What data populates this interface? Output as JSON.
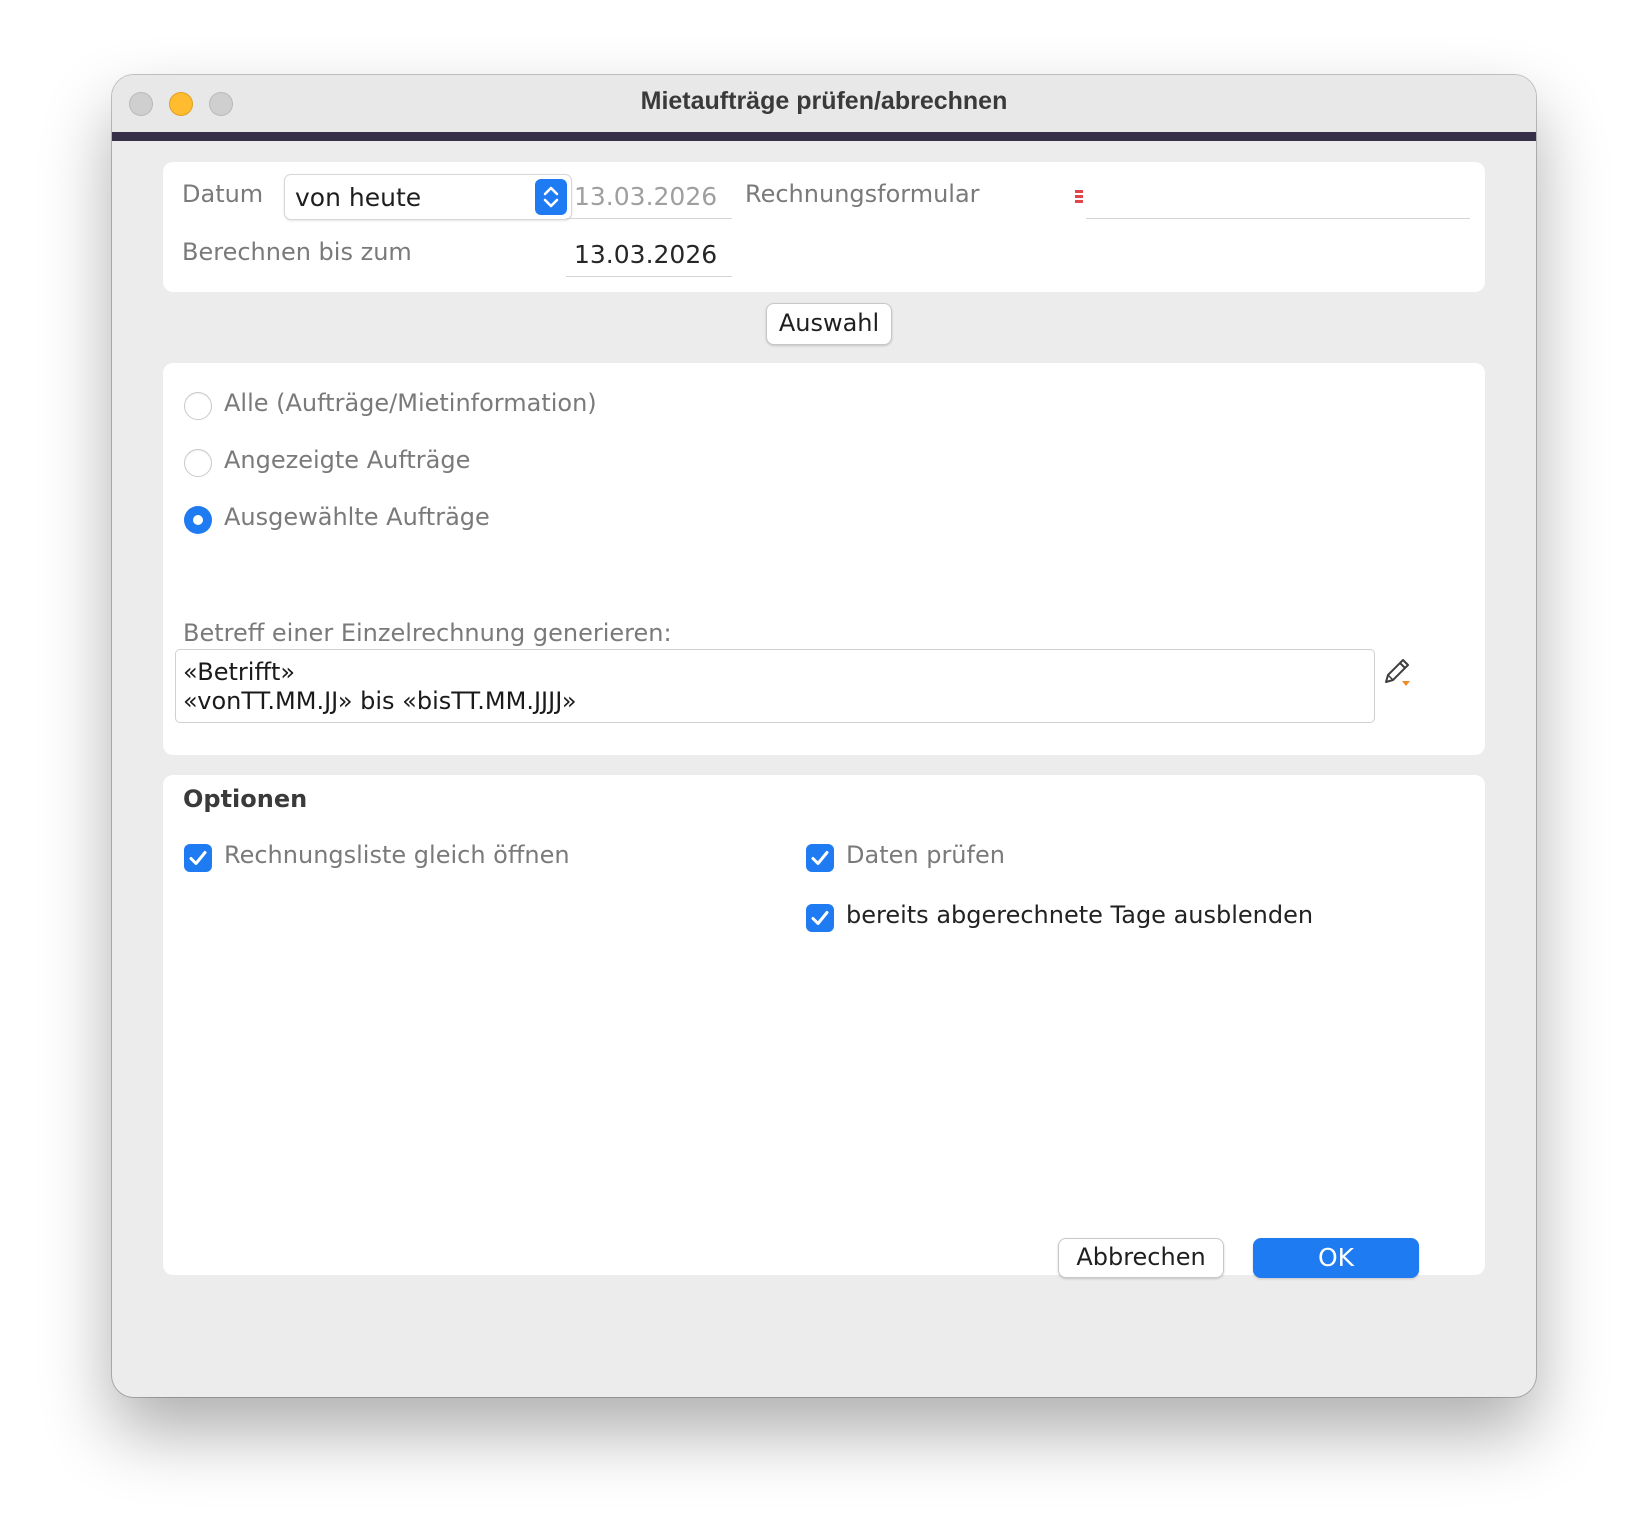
{
  "window": {
    "title": "Mietaufträge prüfen/abrechnen"
  },
  "date_section": {
    "datum_label": "Datum",
    "datum_select_value": "von heute",
    "datum_value": "13.03.2026",
    "rechnungsformular_label": "Rechnungsformular",
    "rechnungsformular_value": "",
    "berechnen_label": "Berechnen bis zum",
    "berechnen_value": "13.03.2026"
  },
  "auswahl_button": "Auswahl",
  "selection": {
    "options": [
      {
        "label": "Alle (Aufträge/Mietinformation)",
        "selected": false
      },
      {
        "label": "Angezeigte Aufträge",
        "selected": false
      },
      {
        "label": "Ausgewählte Aufträge",
        "selected": true
      }
    ],
    "subject_label": "Betreff einer Einzelrechnung generieren:",
    "subject_text": "«Betrifft»\n«vonTT.MM.JJ» bis «bisTT.MM.JJJJ»"
  },
  "options": {
    "title": "Optionen",
    "checkboxes": [
      {
        "label": "Rechnungsliste gleich öffnen",
        "checked": true
      },
      {
        "label": "Daten prüfen",
        "checked": true
      },
      {
        "label": "bereits abgerechnete Tage ausblenden",
        "checked": true
      }
    ]
  },
  "buttons": {
    "cancel": "Abbrechen",
    "ok": "OK"
  },
  "colors": {
    "accent": "#1f7bf2",
    "title_bar_stripe": "#352f48",
    "required_marker": "#e0474b",
    "pencil_indicator": "#f08a24"
  }
}
